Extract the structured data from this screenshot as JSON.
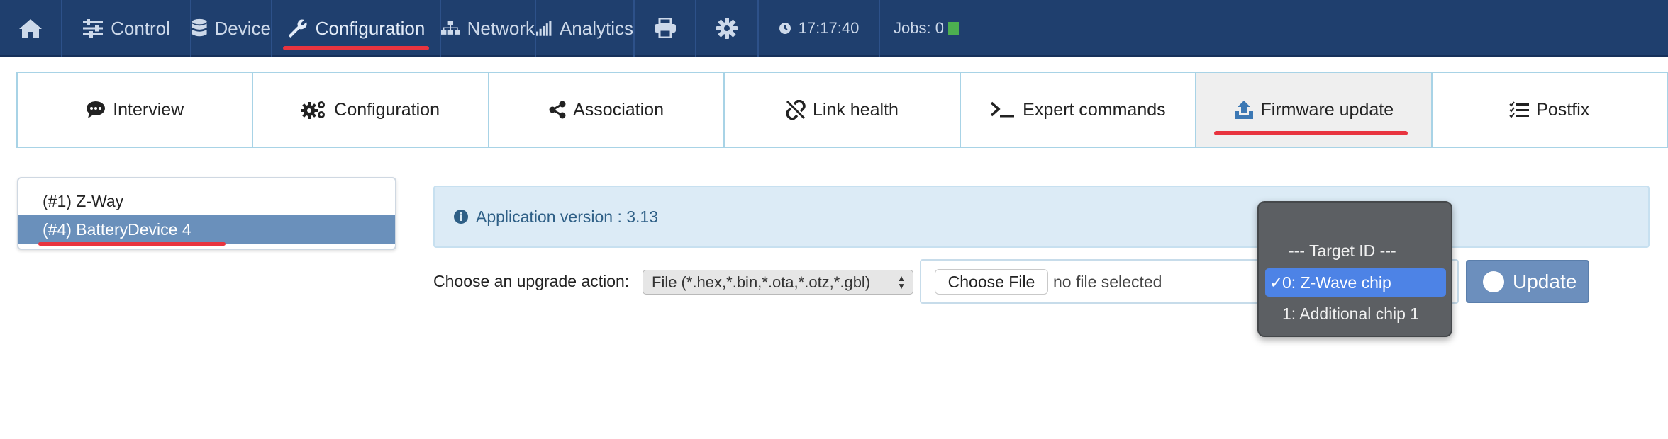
{
  "navbar": {
    "items": [
      {
        "label": "",
        "icon": "home-icon"
      },
      {
        "label": "Control",
        "icon": "sliders-icon"
      },
      {
        "label": "Device",
        "icon": "database-icon"
      },
      {
        "label": "Configuration",
        "icon": "wrench-icon",
        "active": true
      },
      {
        "label": "Network",
        "icon": "sitemap-icon"
      },
      {
        "label": "Analytics",
        "icon": "signal-bars-icon"
      },
      {
        "label": "",
        "icon": "printer-icon"
      },
      {
        "label": "",
        "icon": "gear-icon"
      },
      {
        "label": "17:17:40",
        "icon": "clock-icon"
      },
      {
        "label": "Jobs: 0",
        "icon": "job-status-square-icon"
      }
    ],
    "job_status_color": "#4caf50",
    "background": "#1f3f6e"
  },
  "tabs": [
    {
      "label": "Interview",
      "icon": "comment-icon"
    },
    {
      "label": "Configuration",
      "icon": "gears-icon"
    },
    {
      "label": "Association",
      "icon": "share-icon"
    },
    {
      "label": "Link health",
      "icon": "broken-link-icon"
    },
    {
      "label": "Expert commands",
      "icon": "terminal-icon"
    },
    {
      "label": "Firmware update",
      "icon": "upload-icon",
      "active": true
    },
    {
      "label": "Postfix",
      "icon": "checklist-icon"
    }
  ],
  "devices": [
    {
      "label": "(#1) Z-Way",
      "selected": false
    },
    {
      "label": "(#4) BatteryDevice 4",
      "selected": true
    }
  ],
  "alert": {
    "text": "Application version : 3.13",
    "icon": "info-circle-icon"
  },
  "upgrade": {
    "label": "Choose an upgrade action:",
    "select_value": "File (*.hex,*.bin,*.ota,*.otz,*.gbl)",
    "choose_file_label": "Choose File",
    "no_file_text": "no file selected",
    "update_label": "Update"
  },
  "target_dropdown": {
    "options": [
      {
        "label": "--- Target ID ---",
        "selected": false
      },
      {
        "label": "0: Z-Wave chip",
        "selected": true
      },
      {
        "label": "1: Additional chip 1",
        "selected": false
      }
    ],
    "check_mark": "✓"
  },
  "colors": {
    "accent_underline": "#e8343f",
    "selected_device": "#6a90bb",
    "dropdown_selected": "#4d83e6",
    "update_button": "#6c8fbd"
  }
}
